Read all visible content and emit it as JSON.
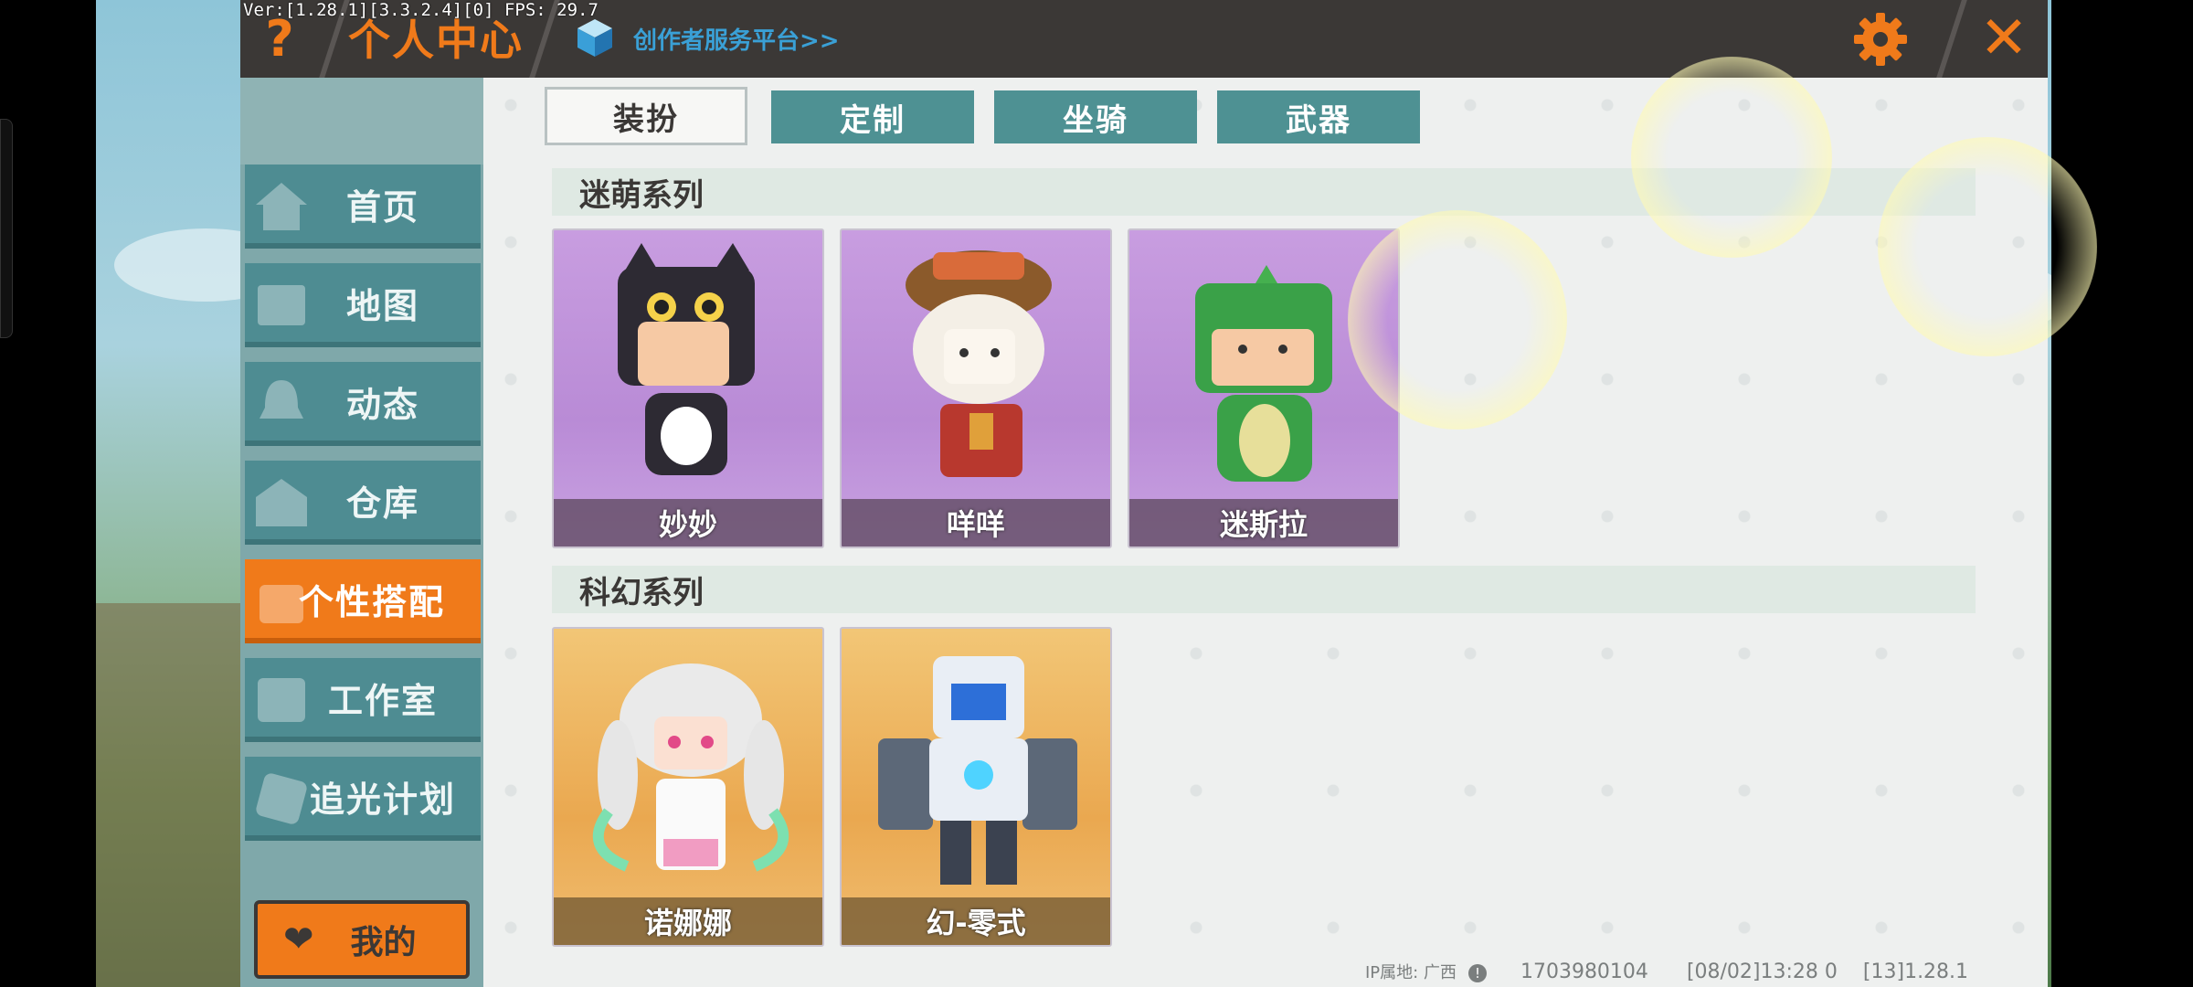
{
  "debug": {
    "fps_text": "Ver:[1.28.1][3.3.2.4][0] FPS: 29.7"
  },
  "header": {
    "help_label": "?",
    "title": "个人中心",
    "creator_link": "创作者服务平台>>",
    "close_label": "✕"
  },
  "sidebar": {
    "items": [
      {
        "label": "首页",
        "icon": "home-icon"
      },
      {
        "label": "地图",
        "icon": "map-icon"
      },
      {
        "label": "动态",
        "icon": "bell-icon"
      },
      {
        "label": "仓库",
        "icon": "warehouse-icon"
      },
      {
        "label": "个性搭配",
        "icon": "outfit-icon",
        "active": true
      },
      {
        "label": "工作室",
        "icon": "studio-icon"
      },
      {
        "label": "追光计划",
        "icon": "light-icon"
      }
    ],
    "mine_label": "我的"
  },
  "tabs": [
    {
      "label": "装扮",
      "active": true
    },
    {
      "label": "定制"
    },
    {
      "label": "坐骑"
    },
    {
      "label": "武器"
    }
  ],
  "sections": [
    {
      "title": "迷萌系列",
      "items": [
        {
          "name": "妙妙",
          "theme": "purple"
        },
        {
          "name": "咩咩",
          "theme": "purple"
        },
        {
          "name": "迷斯拉",
          "theme": "purple"
        }
      ]
    },
    {
      "title": "科幻系列",
      "items": [
        {
          "name": "诺娜娜",
          "theme": "orange"
        },
        {
          "name": "幻-零式",
          "theme": "orange"
        }
      ]
    }
  ],
  "footer": {
    "ip_location": "IP属地: 广西",
    "uid": "1703980104",
    "timestamp": "[08/02]13:28 0",
    "version": "[13]1.28.1"
  },
  "colors": {
    "accent": "#f07a1a",
    "teal": "#4e9193",
    "header_bg": "#3b3836"
  }
}
